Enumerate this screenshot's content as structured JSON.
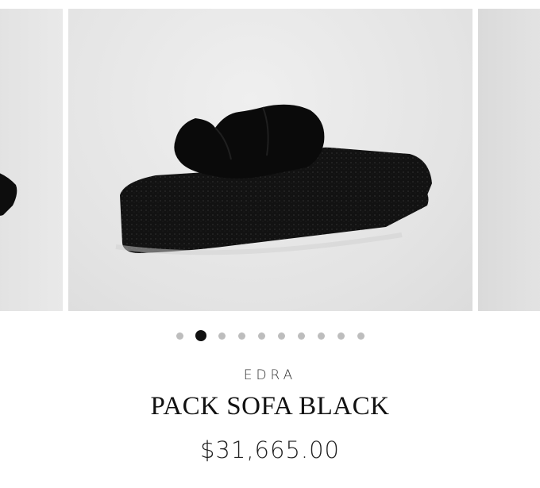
{
  "gallery": {
    "slide_count": 10,
    "active_index": 1,
    "zoom_icon": "magnifier-icon",
    "image_subject": "black-fur-sofa"
  },
  "product": {
    "brand": "EDRA",
    "title": "PACK SOFA BLACK",
    "price": "$31,665.00"
  },
  "colors": {
    "background": "#ffffff",
    "dot_active": "#111111",
    "dot_inactive": "#bdbdbd"
  }
}
